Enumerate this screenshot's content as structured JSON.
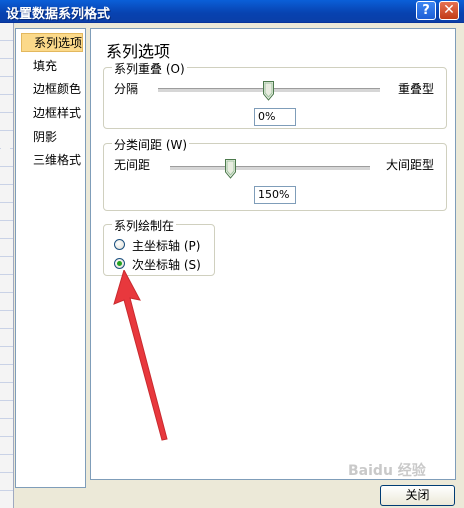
{
  "window": {
    "title": "设置数据系列格式"
  },
  "titlebar": {
    "help": "?",
    "close": "✕"
  },
  "nav": {
    "items": [
      {
        "label": "系列选项",
        "selected": true
      },
      {
        "label": "填充",
        "selected": false
      },
      {
        "label": "边框颜色",
        "selected": false
      },
      {
        "label": "边框样式",
        "selected": false
      },
      {
        "label": "阴影",
        "selected": false
      },
      {
        "label": "三维格式",
        "selected": false
      }
    ]
  },
  "panel": {
    "title": "系列选项",
    "overlap": {
      "legend": "系列重叠 (O)",
      "left_label": "分隔",
      "right_label": "重叠型",
      "value": "0%",
      "slider_fraction": 0.5
    },
    "gap": {
      "legend": "分类间距 (W)",
      "left_label": "无间距",
      "right_label": "大间距型",
      "value": "150%",
      "slider_fraction": 0.3
    },
    "plot_on": {
      "legend": "系列绘制在",
      "options": [
        {
          "label": "主坐标轴 (P)",
          "checked": false
        },
        {
          "label": "次坐标轴 (S)",
          "checked": true
        }
      ]
    }
  },
  "footer": {
    "close_button": "关闭"
  },
  "colors": {
    "arrow": "#e8383d",
    "selection": "#fbd98a",
    "titlebar": "#0842b0"
  }
}
